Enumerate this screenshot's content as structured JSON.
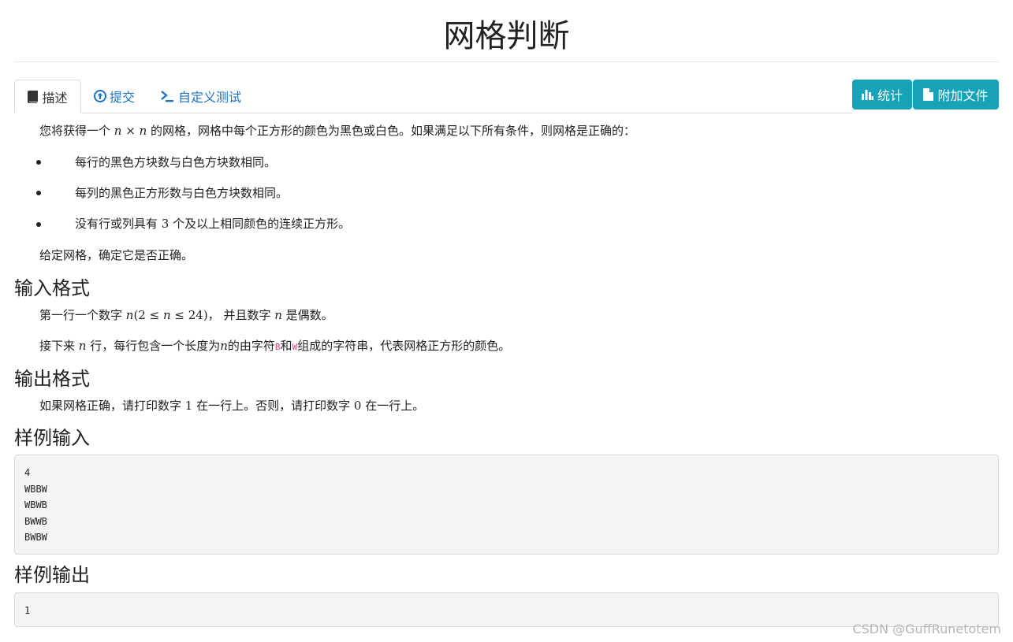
{
  "title": "网格判断",
  "tabs": [
    {
      "label": "描述",
      "icon": "book-icon",
      "active": true
    },
    {
      "label": "提交",
      "icon": "upload-circle-icon",
      "active": false
    },
    {
      "label": "自定义测试",
      "icon": "terminal-icon",
      "active": false
    }
  ],
  "actions": {
    "stats_label": "统计",
    "attachments_label": "附加文件"
  },
  "colors": {
    "accent": "#17a2b8",
    "link": "#1a73c9"
  },
  "description": {
    "intro_before": "您将获得一个 ",
    "n": "n",
    "times": " × ",
    "intro_after": " 的网格，网格中每个正方形的颜色为黑色或白色。如果满足以下所有条件，则网格是正确的：",
    "rules": [
      "每行的黑色方块数与白色方块数相同。",
      "每列的黑色正方形数与白色方块数相同。"
    ],
    "rule3_before": "没有行或列具有 ",
    "rule3_num": "3",
    "rule3_after": " 个及以上相同颜色的连续正方形。",
    "closing": "给定网格，确定它是否正确。"
  },
  "input_format": {
    "heading": "输入格式",
    "line1_before": "第一行一个数字 ",
    "line1_math": "(2 ≤ ",
    "line1_math_end": " ≤ 24)",
    "line1_after": "， 并且数字 ",
    "line1_end": " 是偶数。",
    "line2_before": "接下来 ",
    "line2_mid": " 行，每行包含一个长度为",
    "line2_mid2": "的由字符",
    "char_b": "B",
    "and": "和",
    "char_w": "W",
    "line2_end": "组成的字符串，代表网格正方形的颜色。"
  },
  "output_format": {
    "heading": "输出格式",
    "before": "如果网格正确，请打印数字 ",
    "one": "1",
    "mid": " 在一行上。否则，请打印数字 ",
    "zero": "0",
    "end": " 在一行上。"
  },
  "sample_input": {
    "heading": "样例输入",
    "content": "4\nWBBW\nWBWB\nBWWB\nBWBW"
  },
  "sample_output": {
    "heading": "样例输出",
    "content": "1"
  },
  "watermark": "CSDN @GuffRunetotem"
}
